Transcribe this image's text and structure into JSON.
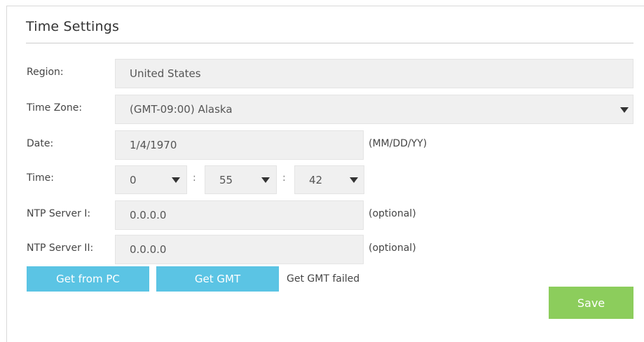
{
  "panel": {
    "title": "Time Settings"
  },
  "region": {
    "label": "Region:",
    "value": "United States"
  },
  "timezone": {
    "label": "Time Zone:",
    "value": "(GMT-09:00) Alaska"
  },
  "date": {
    "label": "Date:",
    "value": "1/4/1970",
    "format_hint": "(MM/DD/YY)"
  },
  "time": {
    "label": "Time:",
    "hour": "0",
    "minute": "55",
    "second": "42",
    "separator": ":"
  },
  "ntp1": {
    "label": "NTP Server I:",
    "value": "0.0.0.0",
    "hint": "(optional)"
  },
  "ntp2": {
    "label": "NTP Server II:",
    "value": "0.0.0.0",
    "hint": "(optional)"
  },
  "buttons": {
    "get_from_pc": "Get from PC",
    "get_gmt": "Get GMT",
    "save": "Save"
  },
  "status": {
    "gmt_result": "Get GMT failed"
  },
  "colors": {
    "button_blue": "#5bc4e4",
    "button_green": "#8ccd5c",
    "field_bg": "#f0f0f0"
  },
  "icons": {
    "dropdown": "chevron-down-icon"
  }
}
